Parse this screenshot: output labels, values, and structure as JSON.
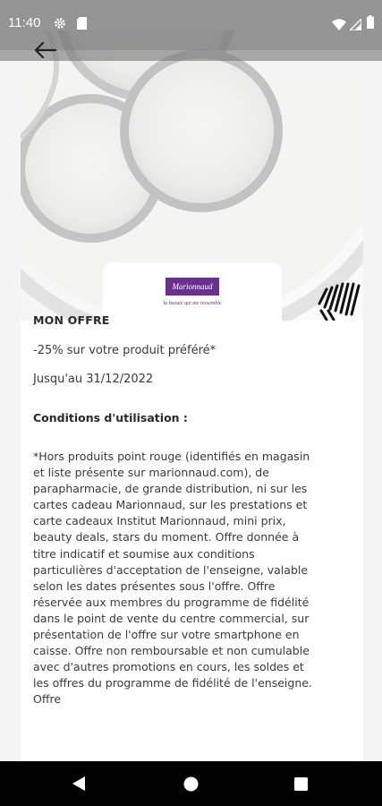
{
  "status_bar": {
    "time": "11:40",
    "icons": [
      "gear-icon",
      "sim-card-icon",
      "wifi-icon",
      "signal-icon",
      "battery-icon"
    ]
  },
  "app_bar": {
    "back_icon": "arrow-left-icon"
  },
  "brand": {
    "logo_text": "Marionnaud",
    "tagline": "la beauté qui me ressemble",
    "color": "#6b2f8e"
  },
  "offer": {
    "heading": "MON OFFRE",
    "description": "-25% sur votre produit préféré*",
    "validity": "Jusqu'au 31/12/2022",
    "conditions_heading": "Conditions d'utilisation :",
    "conditions_text": "*Hors produits point rouge (identifiés en magasin et liste présente sur marionnaud.com), de parapharmacie, de grande distribution, ni sur les cartes cadeau Marionnaud, sur les prestations et carte cadeaux Institut Marionnaud, mini prix, beauty deals, stars du moment. Offre donnée à titre indicatif et soumise aux conditions particulières d'acceptation de l'enseigne, valable selon les dates présentes sous l'offre. Offre réservée aux membres du programme de fidélité dans le point de vente du centre commercial, sur présentation de l'offre sur votre smartphone en caisse. Offre non remboursable et non cumulable avec d'autres promotions en cours, les soldes et les offres du programme de fidélité de l'enseigne. Offre"
  },
  "nav_bar": {
    "icons": [
      "nav-back-icon",
      "nav-home-icon",
      "nav-recents-icon"
    ]
  }
}
